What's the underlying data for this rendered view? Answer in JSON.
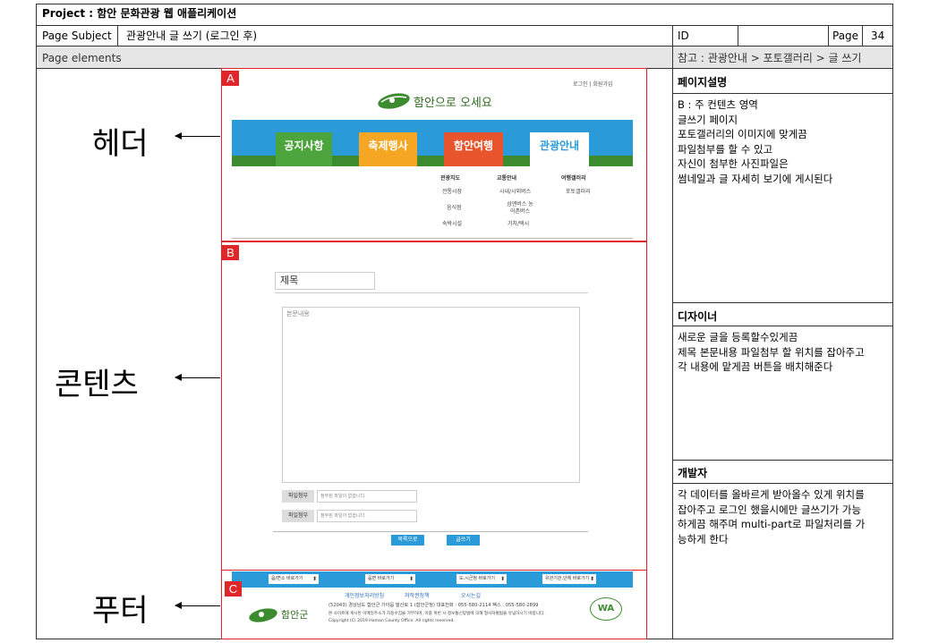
{
  "project": "Project : 함안 문화관광 웹 애플리케이션",
  "page_subject_label": "Page Subject",
  "page_subject": "관광안내 글 쓰기 (로그인 후)",
  "id_label": "ID",
  "id_value": "",
  "page_label": "Page",
  "page_number": "34",
  "page_elements_label": "Page elements",
  "reference": "참고 : 관광안내 > 포토갤러리 > 글 쓰기",
  "labels": {
    "header": "헤더",
    "content": "콘텐츠",
    "footer": "푸터"
  },
  "markers": {
    "a": "A",
    "b": "B",
    "c": "C"
  },
  "mock": {
    "top_links": [
      "로그인",
      "회원가입"
    ],
    "logo_text": "함안으로 오세요",
    "nav": [
      {
        "label": "공지사항",
        "color": "#4ca43c"
      },
      {
        "label": "축제행사",
        "color": "#f5a623"
      },
      {
        "label": "함안여행",
        "color": "#e8542c"
      },
      {
        "label": "관광안내",
        "color": "#2a9ad8"
      }
    ],
    "submenu": {
      "col1_title": "관광지도",
      "col1": [
        "전통시장",
        "음식점",
        "숙박시설"
      ],
      "col2_title": "교통안내",
      "col2": [
        "시내/시외버스",
        "삼엔버스 농어촌버스",
        "기차/택시"
      ],
      "col3_title": "여행갤러리",
      "col3": [
        "포토갤러리"
      ]
    },
    "title_placeholder": "제목",
    "body_placeholder": "본문내용",
    "files": [
      {
        "label": "파일첨부",
        "placeholder": "첨부된 파일이 없습니다."
      },
      {
        "label": "파일첨부",
        "placeholder": "첨부된 파일이 없습니다."
      }
    ],
    "btn_list": "목록으로",
    "btn_write": "글쓰기",
    "footer_selects": [
      "읍/면소 바로가기",
      "읍면 바로가기",
      "도,시군청 바로가기",
      "유관기관,단체 바로가기"
    ],
    "footer_links": [
      "개인정보처리방침",
      "저작권정책",
      "오시는길"
    ],
    "footer_address": "(52043) 경상남도 함안군 가야읍 말산로 1 (함안군청)   대표전화 : 055-580-2114   팩스 : 055-580-2899",
    "footer_notice": "본 사이트에 게시된 이메일주소가 자동수집을 거부하며, 이를 위반 시 정보통신망법에 의해 형사처벌됨을 유념하시기 바랍니다.",
    "footer_copyright": "Copyright (C) 2019 Haman County Office. All rights reserved.",
    "footer_logo": "함안군",
    "footer_badge": "WA"
  },
  "side": {
    "desc_title": "페이지설명",
    "desc_lines": [
      "B : 주 컨텐츠 영역",
      "글쓰기 페이지",
      "포토갤러리의 이미지에 맞게끔",
      "파일첨부를 할 수 있고",
      "자신이 첨부한 사진파일은",
      "썸네일과 글 자세히 보기에 게시된다"
    ],
    "designer_title": "디자이너",
    "designer_lines": [
      "새로운 글을 등록할수있게끔",
      "제목 본문내용 파일첨부 할 위치를 잡아주고",
      "각 내용에 맡게끔 버튼을 배치해준다"
    ],
    "dev_title": "개발자",
    "dev_lines": [
      "각 데이터를 올바르게 받아올수 있게 위치를",
      "잡아주고 로그인 했을시에만 글쓰기가 가능",
      "하게끔 해주며 multi-part로 파일처리를 가",
      "능하게 한다"
    ]
  }
}
